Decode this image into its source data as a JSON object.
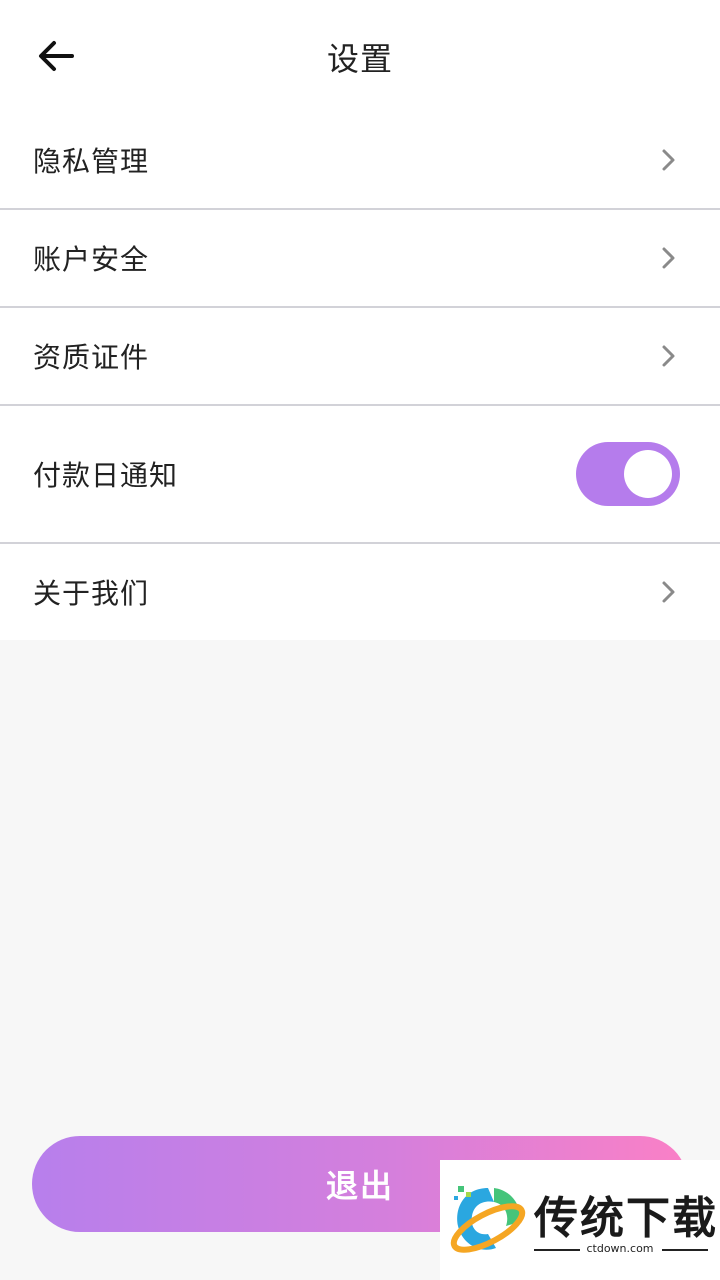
{
  "header": {
    "title": "设置",
    "back_icon": "arrow-left-icon"
  },
  "settings": {
    "items": [
      {
        "label": "隐私管理",
        "control": "chevron"
      },
      {
        "label": "账户安全",
        "control": "chevron"
      },
      {
        "label": "资质证件",
        "control": "chevron"
      },
      {
        "label": "付款日通知",
        "control": "toggle",
        "toggle_on": true
      },
      {
        "label": "关于我们",
        "control": "chevron"
      }
    ]
  },
  "logout": {
    "label": "退出"
  },
  "watermark": {
    "name": "传统下载",
    "url": "ctdown.com"
  },
  "colors": {
    "accent": "#b57cec",
    "gradient_start": "#b77fec",
    "gradient_end": "#fa80c6",
    "divider": "#d2d2d8",
    "background": "#f7f7f7"
  }
}
